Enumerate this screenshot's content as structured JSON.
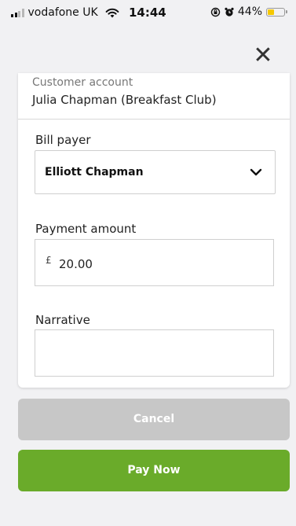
{
  "status_bar": {
    "carrier": "vodafone UK",
    "time": "14:44",
    "battery_percent": "44%",
    "battery_level": 0.44,
    "signal_bars_active": 2,
    "signal_bars_total": 4,
    "battery_color": "#f5c800"
  },
  "header": {
    "close_icon": "close-icon",
    "close_glyph": "✕"
  },
  "form": {
    "customer_account": {
      "label": "Customer account",
      "value": "Julia Chapman (Breakfast Club)"
    },
    "bill_payer": {
      "label": "Bill payer",
      "selected": "Elliott Chapman"
    },
    "payment_amount": {
      "label": "Payment amount",
      "currency": "£",
      "value": "20.00"
    },
    "narrative": {
      "label": "Narrative",
      "value": ""
    }
  },
  "actions": {
    "cancel_label": "Cancel",
    "pay_label": "Pay Now",
    "cancel_color": "#c7c7c7",
    "pay_color": "#6aab2a"
  }
}
